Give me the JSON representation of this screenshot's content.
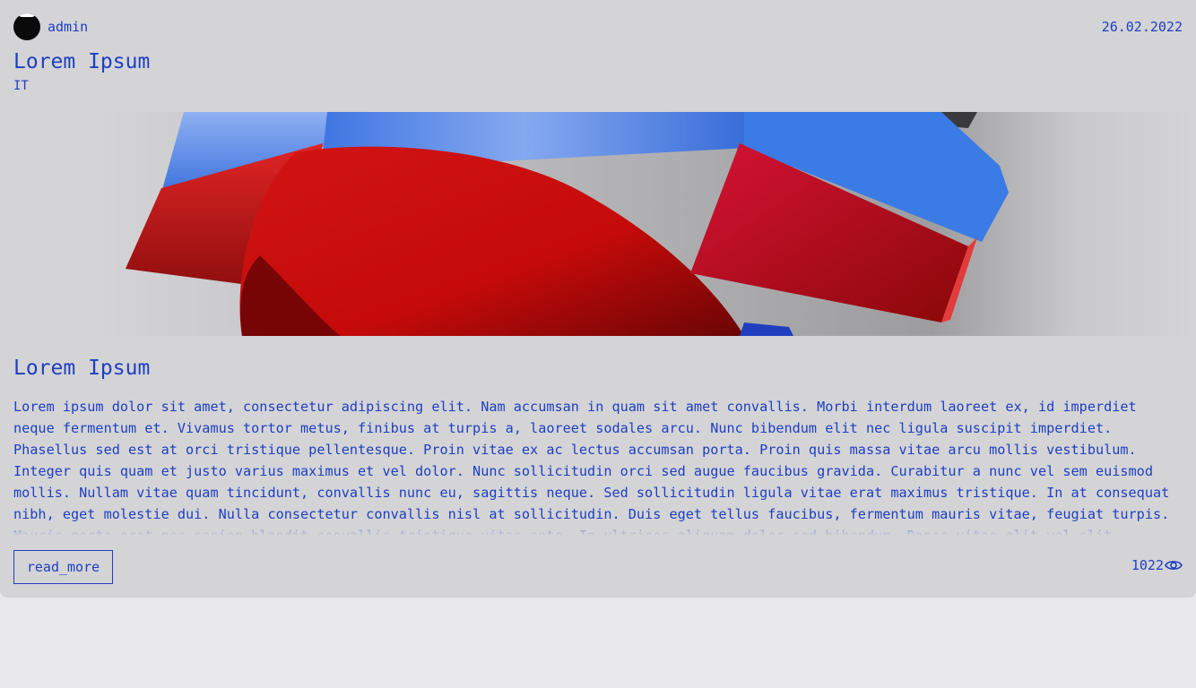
{
  "post": {
    "author": "admin",
    "date": "26.02.2022",
    "title": "Lorem Ipsum",
    "category": "IT",
    "content_title": "Lorem Ipsum",
    "excerpt": "Lorem ipsum dolor sit amet, consectetur adipiscing elit. Nam accumsan in quam sit amet convallis. Morbi interdum laoreet ex, id imperdiet neque fermentum et. Vivamus tortor metus, finibus at turpis a, laoreet sodales arcu. Nunc bibendum elit nec ligula suscipit imperdiet. Phasellus sed est at orci tristique pellentesque. Proin vitae ex ac lectus accumsan porta. Proin quis massa vitae arcu mollis vestibulum. Integer quis quam et justo varius maximus et vel dolor. Nunc sollicitudin orci sed augue faucibus gravida. Curabitur a nunc vel sem euismod mollis. Nullam vitae quam tincidunt, convallis nunc eu, sagittis neque. Sed sollicitudin ligula vitae erat maximus tristique. In at consequat nibh, eget molestie dui. Nulla consectetur convallis nisl at sollicitudin. Duis eget tellus faucibus, fermentum mauris vitae, feugiat turpis. Mauris porta erat nec sapien blandit convallis tristique vitae ante. In ultrices aliquam dolor sed bibendum. Donec vitae elit vel elit. Integer ligula sapien, convallis a eleifend in, suscipit at ligula.",
    "read_more_label": "read_more",
    "views": "1022"
  },
  "icons": {
    "avatar": "avatar-icon",
    "views": "eye-icon"
  },
  "colors": {
    "accent": "#1e3fbf",
    "card_background": "#d4d4d7",
    "page_background": "#e8e8ea"
  }
}
